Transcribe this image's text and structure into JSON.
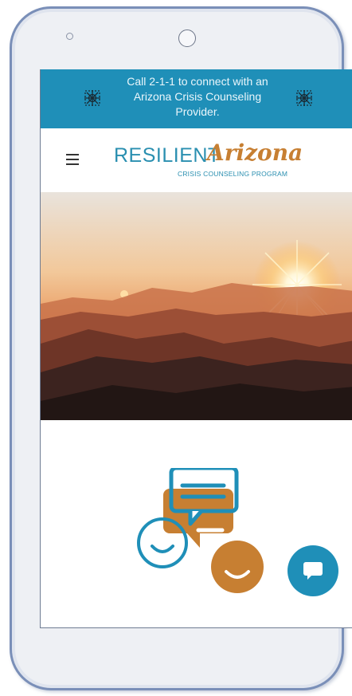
{
  "banner": {
    "line1": "Call 2-1-1 to connect with an",
    "line2": "Arizona Crisis Counseling",
    "line3": "Provider.",
    "icon_left": "virus-icon",
    "icon_right": "virus-icon",
    "background": "#1f8fb8"
  },
  "header": {
    "menu_icon": "hamburger-menu-icon",
    "logo": {
      "main": "RESILIENT",
      "script": "Arizona",
      "sub": "CRISIS COUNSELING PROGRAM"
    }
  },
  "hero": {
    "image": "sunset-over-mountains"
  },
  "illustration": {
    "icon": "conversation-icon"
  },
  "chat_button": {
    "icon": "chat-icon",
    "color": "#1f8fb8"
  },
  "colors": {
    "brand_blue": "#2a8fb0",
    "brand_orange": "#c77f32"
  }
}
